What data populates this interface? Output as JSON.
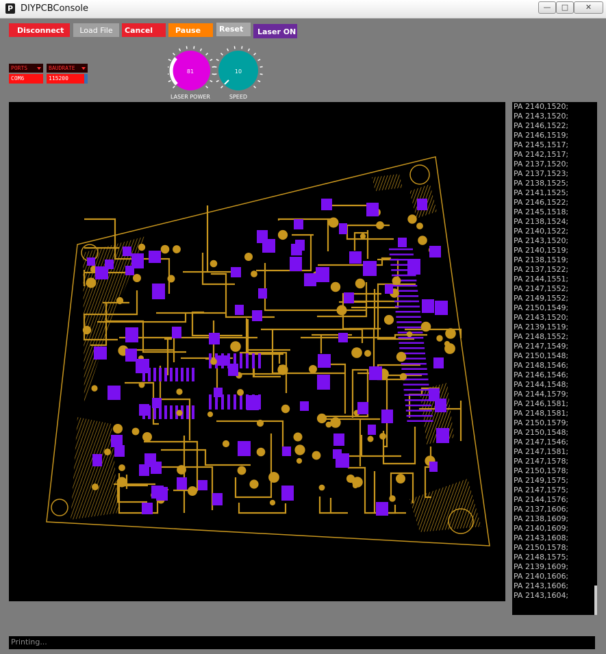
{
  "window": {
    "title": "DIYPCBConsole",
    "icon_glyph": "P"
  },
  "toolbar": {
    "disconnect": "Disconnect",
    "load_file": "Load File",
    "cancel": "Cancel",
    "pause": "Pause",
    "reset": "Reset",
    "laser_on": "Laser ON"
  },
  "serial": {
    "ports_label": "PORTS",
    "port_value": "COM6",
    "baud_label": "BAUDRATE",
    "baud_value": "115200"
  },
  "knobs": {
    "laser_power": {
      "label": "LASER POWER",
      "value": "81",
      "color": "#e000e0"
    },
    "speed": {
      "label": "SPEED",
      "value": "10",
      "color": "#00a0a0"
    }
  },
  "colors": {
    "disconnect": "#e8202c",
    "load_file": "#a0a0a0",
    "cancel": "#e8202c",
    "pause": "#ff8000",
    "reset": "#a8a8a8",
    "laser_on": "#6a2a9a",
    "trace": "#c8961e",
    "pad": "#7a10f0"
  },
  "console_lines": [
    "PA 2140,1520;",
    "PA 2143,1520;",
    "PA 2146,1522;",
    "PA 2146,1519;",
    "PA 2145,1517;",
    "PA 2142,1517;",
    "PA 2137,1520;",
    "PA 2137,1523;",
    "PA 2138,1525;",
    "PA 2141,1525;",
    "PA 2146,1522;",
    "PA 2145,1518;",
    "PA 2138,1524;",
    "PA 2140,1522;",
    "PA 2143,1520;",
    "PA 2140,1519;",
    "PA 2138,1519;",
    "PA 2137,1522;",
    "PA 2144,1551;",
    "PA 2147,1552;",
    "PA 2149,1552;",
    "PA 2150,1549;",
    "PA 2143,1520;",
    "PA 2139,1519;",
    "PA 2148,1552;",
    "PA 2147,1549;",
    "PA 2150,1548;",
    "PA 2148,1546;",
    "PA 2146,1546;",
    "PA 2144,1548;",
    "PA 2144,1579;",
    "PA 2146,1581;",
    "PA 2148,1581;",
    "PA 2150,1579;",
    "PA 2150,1548;",
    "PA 2147,1546;",
    "PA 2147,1581;",
    "PA 2147,1578;",
    "PA 2150,1578;",
    "PA 2149,1575;",
    "PA 2147,1575;",
    "PA 2144,1576;",
    "PA 2137,1606;",
    "PA 2138,1609;",
    "PA 2140,1609;",
    "PA 2143,1608;",
    "PA 2150,1578;",
    "PA 2148,1575;",
    "PA 2139,1609;",
    "PA 2140,1606;",
    "PA 2143,1606;",
    "PA 2143,1604;"
  ],
  "status": {
    "text": "Printing..."
  }
}
